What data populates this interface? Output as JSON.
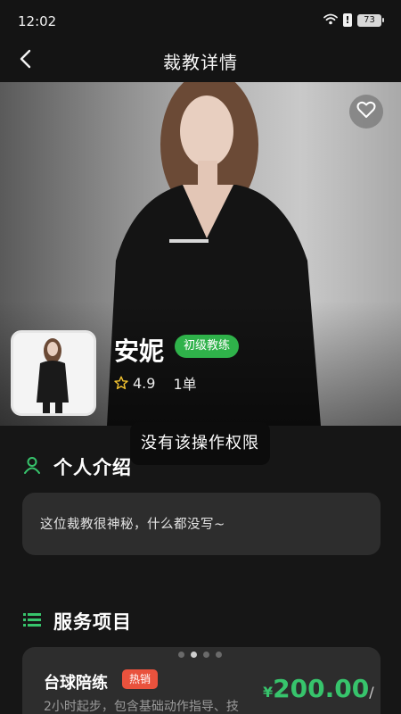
{
  "status_bar": {
    "time": "12:02",
    "alert": "!",
    "battery": "73"
  },
  "nav": {
    "title": "裁教详情"
  },
  "coach": {
    "name": "安妮",
    "level": "初级教练",
    "rating": "4.9",
    "orders": "1单"
  },
  "toast": "没有该操作权限",
  "intro": {
    "title": "个人介绍",
    "text": "这位裁教很神秘，什么都没写~"
  },
  "services": {
    "title": "服务项目",
    "dots_count": 4,
    "active_dot": 1,
    "item": {
      "name": "台球陪练",
      "tag": "热销",
      "desc": "2小时起步，包含基础动作指导、技",
      "currency": "¥",
      "price": "200.00",
      "unit": "/"
    }
  },
  "colors": {
    "accent_green": "#37c46c",
    "badge_green": "#2fb24a",
    "hot_red": "#e9523d",
    "card_bg": "#2d2d2d",
    "page_bg": "#161616"
  }
}
